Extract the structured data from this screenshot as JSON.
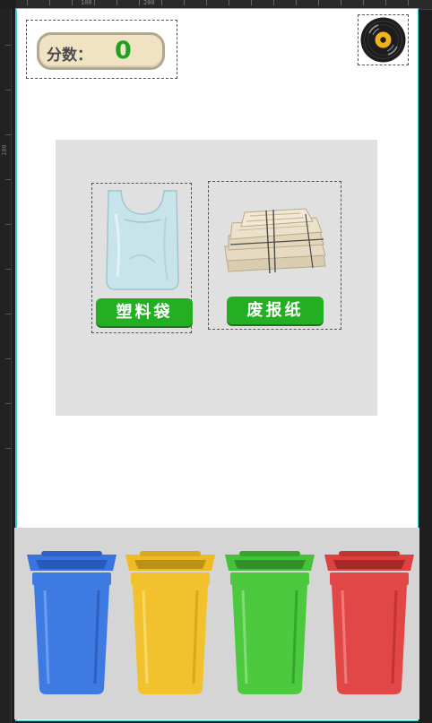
{
  "ruler": {
    "top_numbers": [
      "100",
      "200"
    ],
    "left_numbers": [
      "100"
    ]
  },
  "score": {
    "label": "分数：",
    "value": "0",
    "value_color": "#20a020"
  },
  "music_button": {
    "icon": "vinyl-record-icon"
  },
  "items": [
    {
      "label": "塑料袋",
      "icon": "plastic-bag-icon"
    },
    {
      "label": "废报纸",
      "icon": "newspaper-bundle-icon"
    }
  ],
  "bins": [
    {
      "color": "#3d7be3",
      "icon": "blue-trash-bin-icon"
    },
    {
      "color": "#f2c12e",
      "icon": "yellow-trash-bin-icon"
    },
    {
      "color": "#4cc93f",
      "icon": "green-trash-bin-icon"
    },
    {
      "color": "#e24747",
      "icon": "red-trash-bin-icon"
    }
  ]
}
